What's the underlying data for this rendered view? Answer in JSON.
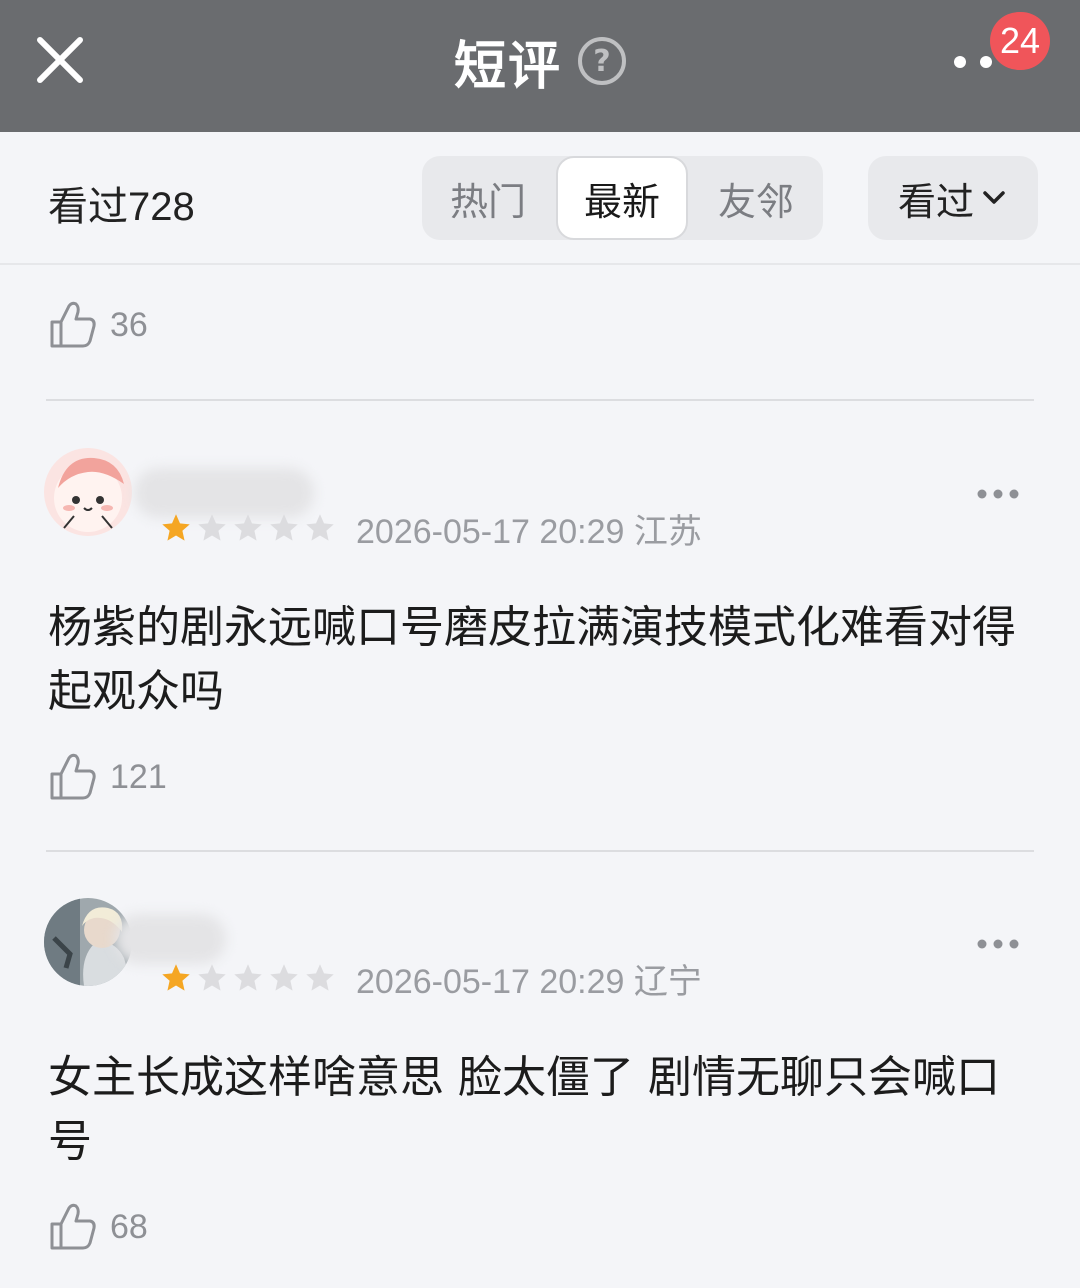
{
  "header": {
    "title": "短评",
    "help_glyph": "?",
    "notification_badge": "24"
  },
  "filter": {
    "watched_label": "看过728",
    "tabs": [
      {
        "label": "热门",
        "active": false
      },
      {
        "label": "最新",
        "active": true
      },
      {
        "label": "友邻",
        "active": false
      }
    ],
    "dropdown_label": "看过"
  },
  "top_partial": {
    "likes": "36"
  },
  "comments": [
    {
      "rating_stars": 1,
      "timestamp": "2026-05-17 20:29",
      "location": "江苏",
      "text": "杨紫的剧永远喊口号磨皮拉满演技模式化难看对得起观众吗",
      "likes": "121"
    },
    {
      "rating_stars": 1,
      "timestamp": "2026-05-17 20:29",
      "location": "辽宁",
      "text": "女主长成这样啥意思 脸太僵了 剧情无聊只会喊口号",
      "likes": "68"
    }
  ],
  "colors": {
    "topbar": "#6a6c6f",
    "badge": "#f0555a",
    "star_filled": "#f5a623",
    "star_empty": "#dcdcdf"
  }
}
